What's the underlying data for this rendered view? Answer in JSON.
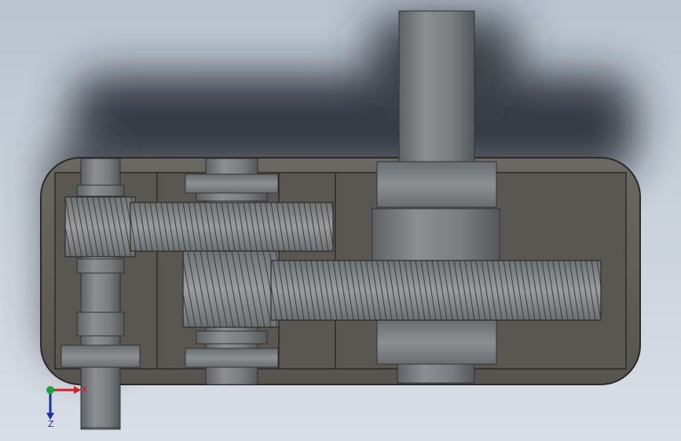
{
  "viewport": {
    "background": "#c5cdd6",
    "shadow_color": "#1e232b",
    "housing_color": "#5d5a55",
    "housing_outline": "#2b2a28",
    "shaft_color": "#7c7f81",
    "gear_color": "#8a8c8d",
    "gear_tooth_line": "#3a3b3c"
  },
  "triad": {
    "x_label": "X",
    "z_label": "Z",
    "x_color": "#d0202a",
    "y_color": "#1aa33a",
    "z_color": "#1a2fb0"
  }
}
